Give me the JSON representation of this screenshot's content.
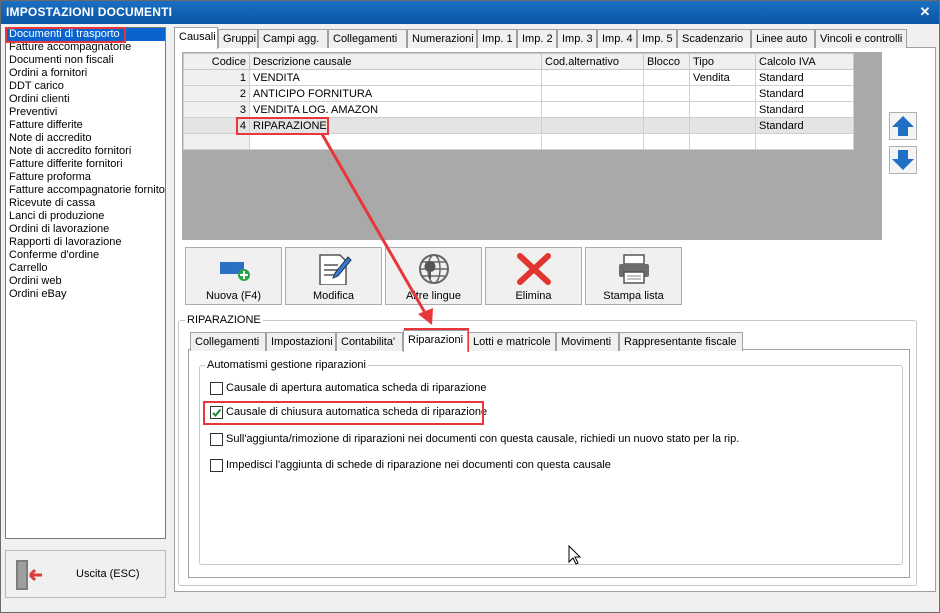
{
  "window": {
    "title": "IMPOSTAZIONI DOCUMENTI",
    "close_glyph": "✕"
  },
  "doclist": {
    "items": [
      "Documenti di trasporto",
      "Fatture accompagnatorie",
      "Documenti non fiscali",
      "Ordini a fornitori",
      "DDT carico",
      "Ordini clienti",
      "Preventivi",
      "Fatture differite",
      "Note di accredito",
      "Note di accredito fornitori",
      "Fatture differite fornitori",
      "Fatture proforma",
      "Fatture accompagnatorie fornito",
      "Ricevute di cassa",
      "Lanci di produzione",
      "Ordini di lavorazione",
      "Rapporti di lavorazione",
      "Conferme d'ordine",
      "Carrello",
      "Ordini web",
      "Ordini eBay"
    ],
    "selected_index": 0
  },
  "exit": {
    "label": "Uscita (ESC)",
    "icon": "exit-door-icon"
  },
  "top_tabs": [
    "Causali",
    "Gruppi",
    "Campi agg.",
    "Collegamenti",
    "Numerazioni",
    "Imp. 1",
    "Imp. 2",
    "Imp. 3",
    "Imp. 4",
    "Imp. 5",
    "Scadenzario",
    "Linee auto",
    "Vincoli e controlli"
  ],
  "active_top_tab": "Causali",
  "grid": {
    "columns": [
      "Codice",
      "Descrizione causale",
      "Cod.alternativo",
      "Blocco",
      "Tipo",
      "Calcolo IVA"
    ],
    "rows": [
      {
        "code": "1",
        "desc": "VENDITA",
        "alt": "",
        "blocco": "",
        "tipo": "Vendita",
        "iva": "Standard"
      },
      {
        "code": "2",
        "desc": "ANTICIPO FORNITURA",
        "alt": "",
        "blocco": "",
        "tipo": "",
        "iva": "Standard"
      },
      {
        "code": "3",
        "desc": "VENDITA LOG. AMAZON",
        "alt": "",
        "blocco": "",
        "tipo": "",
        "iva": "Standard"
      },
      {
        "code": "4",
        "desc": "RIPARAZIONE",
        "alt": "",
        "blocco": "",
        "tipo": "",
        "iva": "Standard"
      }
    ],
    "selected_row": 3
  },
  "actions": [
    {
      "label": "Nuova (F4)",
      "icon": "new-record-icon"
    },
    {
      "label": "Modifica",
      "icon": "edit-document-icon"
    },
    {
      "label": "Altre lingue",
      "icon": "globe-location-icon"
    },
    {
      "label": "Elimina",
      "icon": "delete-x-icon"
    },
    {
      "label": "Stampa lista",
      "icon": "printer-icon"
    }
  ],
  "riparazione": {
    "group_title": "RIPARAZIONE",
    "tabs": [
      "Collegamenti",
      "Impostazioni",
      "Contabilita'",
      "Riparazioni",
      "Lotti e matricole",
      "Movimenti",
      "Rappresentante fiscale"
    ],
    "active_tab": "Riparazioni",
    "section_title": "Automatismi gestione riparazioni",
    "options": [
      {
        "label": "Causale di apertura automatica scheda di riparazione",
        "checked": false
      },
      {
        "label": "Causale di chiusura automatica scheda di riparazione",
        "checked": true
      },
      {
        "label": "Sull'aggiunta/rimozione di riparazioni nei documenti con questa causale, richiedi un nuovo stato per la rip.",
        "checked": false
      },
      {
        "label": "Impedisci l'aggiunta di schede di riparazione nei documenti con questa causale",
        "checked": false
      }
    ]
  },
  "colors": {
    "highlight": "#e8363a",
    "titlebar": "#0a55a8",
    "selection": "#0a64d0",
    "arrow_blue": "#1f6fc5"
  }
}
